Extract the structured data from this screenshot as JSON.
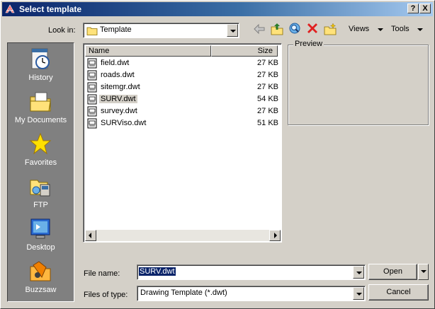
{
  "window": {
    "title": "Select template"
  },
  "title_buttons": {
    "help": "?",
    "close": "X"
  },
  "toolbar": {
    "look_in_label": "Look in:",
    "look_in_value": "Template",
    "views_label": "Views",
    "tools_label": "Tools"
  },
  "places": [
    {
      "label": "History",
      "icon": "history-icon"
    },
    {
      "label": "My Documents",
      "icon": "my-documents-icon"
    },
    {
      "label": "Favorites",
      "icon": "favorites-icon"
    },
    {
      "label": "FTP",
      "icon": "ftp-icon"
    },
    {
      "label": "Desktop",
      "icon": "desktop-icon"
    },
    {
      "label": "Buzzsaw",
      "icon": "buzzsaw-icon"
    }
  ],
  "filelist": {
    "columns": {
      "name": "Name",
      "size": "Size"
    },
    "files": [
      {
        "name": "field.dwt",
        "size": "27 KB"
      },
      {
        "name": "roads.dwt",
        "size": "27 KB"
      },
      {
        "name": "sitemgr.dwt",
        "size": "27 KB"
      },
      {
        "name": "SURV.dwt",
        "size": "54 KB",
        "selected": true
      },
      {
        "name": "survey.dwt",
        "size": "27 KB"
      },
      {
        "name": "SURViso.dwt",
        "size": "51 KB"
      }
    ]
  },
  "preview": {
    "label": "Preview"
  },
  "form": {
    "file_name_label": "File name:",
    "file_name_value": "SURV.dwt",
    "file_type_label": "Files of type:",
    "file_type_value": "Drawing Template (*.dwt)"
  },
  "buttons": {
    "open": "Open",
    "cancel": "Cancel"
  },
  "colors": {
    "title_start": "#0a246a",
    "title_end": "#a6caf0",
    "dialog_bg": "#d4d0c8",
    "places_bg": "#808080"
  }
}
